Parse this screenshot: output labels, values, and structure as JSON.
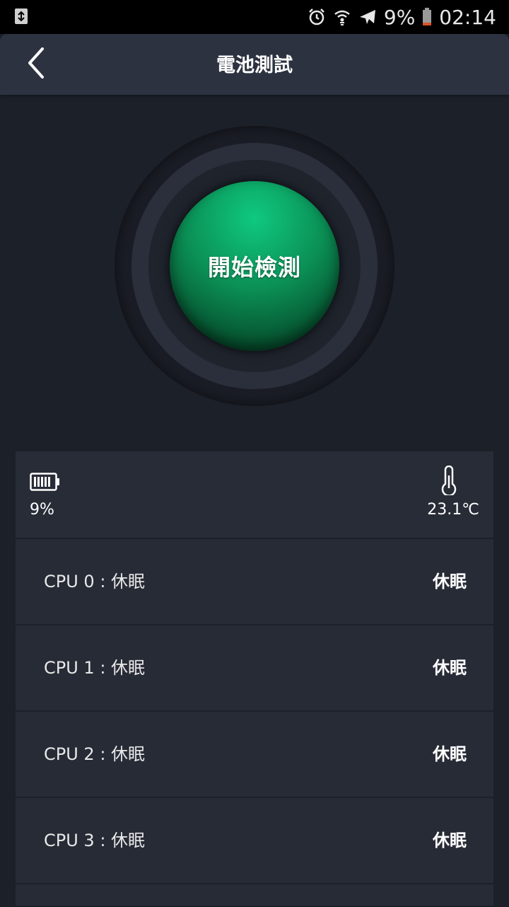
{
  "status_bar": {
    "battery_percent": "9%",
    "time": "02:14",
    "icons": [
      "recycle-icon",
      "alarm-icon",
      "wifi-icon",
      "airplane-icon",
      "battery-icon"
    ]
  },
  "app_bar": {
    "title": "電池測試",
    "back_icon": "chevron-left-icon"
  },
  "start_button": {
    "label": "開始檢測",
    "color": "#0b8f55"
  },
  "info": {
    "battery_level": "9%",
    "temperature": "23.1℃"
  },
  "cpu_rows": [
    {
      "name": "CPU  0 : 休眠",
      "state": "休眠"
    },
    {
      "name": "CPU  1 : 休眠",
      "state": "休眠"
    },
    {
      "name": "CPU  2 : 休眠",
      "state": "休眠"
    },
    {
      "name": "CPU  3 : 休眠",
      "state": "休眠"
    }
  ],
  "colors": {
    "background": "#1c2029",
    "app_bar": "#2c3240",
    "panel": "#272c37",
    "accent_green": "#0fc980",
    "battery_low": "#d9532c"
  }
}
